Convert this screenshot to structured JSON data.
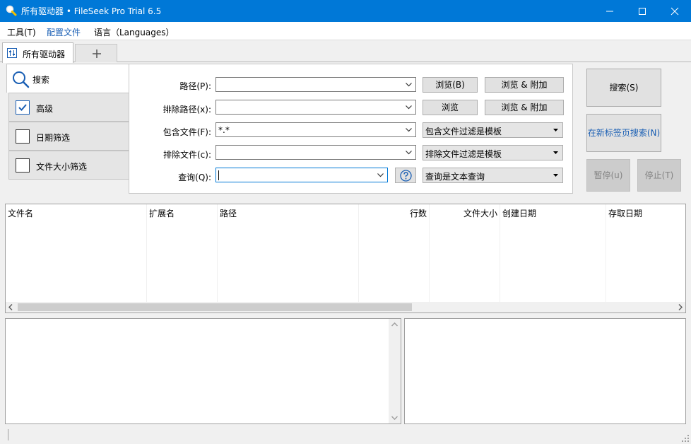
{
  "window": {
    "title": "所有驱动器 • FileSeek Pro Trial 6.5"
  },
  "menu": {
    "items": [
      "工具(T)",
      "配置文件",
      "语言（Languages）"
    ]
  },
  "tabs": {
    "active_label": "所有驱动器",
    "add_label": "+"
  },
  "sidebar": {
    "search_label": "搜索",
    "items": [
      {
        "label": "高级",
        "checked": true
      },
      {
        "label": "日期筛选",
        "checked": false
      },
      {
        "label": "文件大小筛选",
        "checked": false
      }
    ]
  },
  "form": {
    "path_label": "路径(P):",
    "path_value": "",
    "browse_label": "浏览(B)",
    "browse_append_label": "浏览 & 附加",
    "exclude_path_label": "排除路径(x):",
    "exclude_path_value": "",
    "browse2_label": "浏览",
    "browse_append2_label": "浏览 & 附加",
    "include_files_label": "包含文件(F):",
    "include_files_value": "*.*",
    "include_mode": "包含文件过滤是模板",
    "exclude_files_label": "排除文件(c):",
    "exclude_files_value": "",
    "exclude_mode": "排除文件过滤是模板",
    "query_label": "查询(Q):",
    "query_value": "",
    "query_mode": "查询是文本查询"
  },
  "actions": {
    "search": "搜索(S)",
    "search_new_tab": "在新标签页搜索(N)",
    "pause": "暂停(u)",
    "stop": "停止(T)"
  },
  "results": {
    "columns": [
      "文件名",
      "扩展名",
      "路径",
      "行数",
      "文件大小",
      "创建日期",
      "存取日期"
    ]
  },
  "colors": {
    "titlebar": "#0078d7",
    "link": "#1a5fb4",
    "check": "#1a5fb4"
  }
}
